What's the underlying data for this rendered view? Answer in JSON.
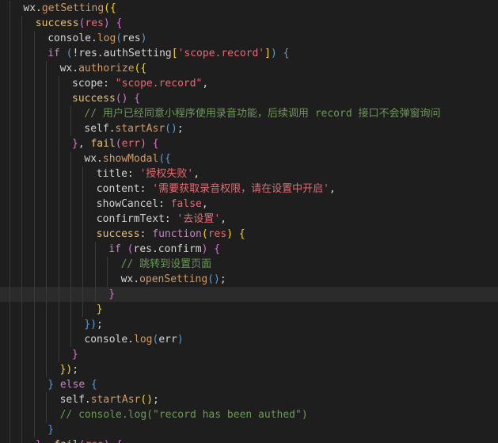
{
  "editor": {
    "lines": [
      {
        "indent": 1,
        "tokens": [
          [
            "t-plain",
            "wx."
          ],
          [
            "t-method",
            "getSetting"
          ],
          [
            "t-brace",
            "({"
          ]
        ]
      },
      {
        "indent": 2,
        "tokens": [
          [
            "t-yellow",
            "success"
          ],
          [
            "t-brace2",
            "("
          ],
          [
            "t-pink",
            "res"
          ],
          [
            "t-brace2",
            ")"
          ],
          [
            "t-plain",
            " "
          ],
          [
            "t-brace2",
            "{"
          ]
        ]
      },
      {
        "indent": 3,
        "tokens": [
          [
            "t-plain",
            "console."
          ],
          [
            "t-method",
            "log"
          ],
          [
            "t-brace3",
            "("
          ],
          [
            "t-plain",
            "res"
          ],
          [
            "t-brace3",
            ")"
          ]
        ]
      },
      {
        "indent": 3,
        "tokens": [
          [
            "t-kw",
            "if"
          ],
          [
            "t-plain",
            " "
          ],
          [
            "t-brace3",
            "("
          ],
          [
            "t-plain",
            "!res.authSetting"
          ],
          [
            "t-brace",
            "["
          ],
          [
            "t-strE",
            "'scope.record'"
          ],
          [
            "t-brace",
            "]"
          ],
          [
            "t-brace3",
            ")"
          ],
          [
            "t-plain",
            " "
          ],
          [
            "t-brace3",
            "{"
          ]
        ]
      },
      {
        "indent": 4,
        "tokens": [
          [
            "t-plain",
            "wx."
          ],
          [
            "t-method",
            "authorize"
          ],
          [
            "t-brace",
            "({"
          ]
        ]
      },
      {
        "indent": 5,
        "tokens": [
          [
            "t-plain",
            "scope: "
          ],
          [
            "t-strE",
            "\"scope.record\""
          ],
          [
            "t-plain",
            ","
          ]
        ]
      },
      {
        "indent": 5,
        "tokens": [
          [
            "t-yellow",
            "success"
          ],
          [
            "t-brace2",
            "()"
          ],
          [
            "t-plain",
            " "
          ],
          [
            "t-brace2",
            "{"
          ]
        ]
      },
      {
        "indent": 6,
        "tokens": [
          [
            "t-cm",
            "// 用户已经同意小程序使用录音功能，后续调用 record 接口不会弹窗询问"
          ]
        ]
      },
      {
        "indent": 6,
        "tokens": [
          [
            "t-plain",
            "self."
          ],
          [
            "t-method",
            "startAsr"
          ],
          [
            "t-brace3",
            "()"
          ],
          [
            "t-plain",
            ";"
          ]
        ]
      },
      {
        "indent": 5,
        "tokens": [
          [
            "t-brace2",
            "}"
          ],
          [
            "t-plain",
            ", "
          ],
          [
            "t-yellow",
            "fail"
          ],
          [
            "t-brace2",
            "("
          ],
          [
            "t-pink",
            "err"
          ],
          [
            "t-brace2",
            ")"
          ],
          [
            "t-plain",
            " "
          ],
          [
            "t-brace2",
            "{"
          ]
        ]
      },
      {
        "indent": 6,
        "tokens": [
          [
            "t-plain",
            "wx."
          ],
          [
            "t-method",
            "showModal"
          ],
          [
            "t-brace3",
            "({"
          ]
        ]
      },
      {
        "indent": 7,
        "tokens": [
          [
            "t-plain",
            "title: "
          ],
          [
            "t-strE",
            "'授权失败'"
          ],
          [
            "t-plain",
            ","
          ]
        ]
      },
      {
        "indent": 7,
        "tokens": [
          [
            "t-plain",
            "content: "
          ],
          [
            "t-strE",
            "'需要获取录音权限，请在设置中开启'"
          ],
          [
            "t-plain",
            ","
          ]
        ]
      },
      {
        "indent": 7,
        "tokens": [
          [
            "t-plain",
            "showCancel: "
          ],
          [
            "t-bool",
            "false"
          ],
          [
            "t-plain",
            ","
          ]
        ]
      },
      {
        "indent": 7,
        "tokens": [
          [
            "t-plain",
            "confirmText: "
          ],
          [
            "t-strE",
            "'去设置'"
          ],
          [
            "t-plain",
            ","
          ]
        ]
      },
      {
        "indent": 7,
        "tokens": [
          [
            "t-yellow",
            "success"
          ],
          [
            "t-plain",
            ": "
          ],
          [
            "t-kw",
            "function"
          ],
          [
            "t-brace",
            "("
          ],
          [
            "t-pink",
            "res"
          ],
          [
            "t-brace",
            ")"
          ],
          [
            "t-plain",
            " "
          ],
          [
            "t-brace",
            "{"
          ]
        ]
      },
      {
        "indent": 8,
        "tokens": [
          [
            "t-kw",
            "if"
          ],
          [
            "t-plain",
            " "
          ],
          [
            "t-brace2",
            "("
          ],
          [
            "t-plain",
            "res.confirm"
          ],
          [
            "t-brace2",
            ")"
          ],
          [
            "t-plain",
            " "
          ],
          [
            "t-brace2",
            "{"
          ]
        ]
      },
      {
        "indent": 9,
        "tokens": [
          [
            "t-cm",
            "// 跳转到设置页面"
          ]
        ]
      },
      {
        "indent": 9,
        "tokens": [
          [
            "t-plain",
            "wx."
          ],
          [
            "t-method",
            "openSetting"
          ],
          [
            "t-brace3",
            "()"
          ],
          [
            "t-plain",
            ";"
          ]
        ]
      },
      {
        "indent": 8,
        "tokens": [
          [
            "t-brace2",
            "}"
          ]
        ]
      },
      {
        "indent": 7,
        "tokens": [
          [
            "t-brace",
            "}"
          ]
        ]
      },
      {
        "indent": 6,
        "tokens": [
          [
            "t-brace3",
            "})"
          ],
          [
            "t-plain",
            ";"
          ]
        ]
      },
      {
        "indent": 6,
        "tokens": [
          [
            "t-plain",
            "console."
          ],
          [
            "t-method",
            "log"
          ],
          [
            "t-brace3",
            "("
          ],
          [
            "t-plain",
            "err"
          ],
          [
            "t-brace3",
            ")"
          ]
        ]
      },
      {
        "indent": 5,
        "tokens": [
          [
            "t-brace2",
            "}"
          ]
        ]
      },
      {
        "indent": 4,
        "tokens": [
          [
            "t-brace",
            "})"
          ],
          [
            "t-plain",
            ";"
          ]
        ]
      },
      {
        "indent": 3,
        "tokens": [
          [
            "t-brace3",
            "}"
          ],
          [
            "t-plain",
            " "
          ],
          [
            "t-kw",
            "else"
          ],
          [
            "t-plain",
            " "
          ],
          [
            "t-brace3",
            "{"
          ]
        ]
      },
      {
        "indent": 4,
        "tokens": [
          [
            "t-plain",
            "self."
          ],
          [
            "t-method",
            "startAsr"
          ],
          [
            "t-brace",
            "()"
          ],
          [
            "t-plain",
            ";"
          ]
        ]
      },
      {
        "indent": 4,
        "tokens": [
          [
            "t-cm",
            "// console.log(\"record has been authed\")"
          ]
        ]
      },
      {
        "indent": 3,
        "tokens": [
          [
            "t-brace3",
            "}"
          ]
        ]
      },
      {
        "indent": 2,
        "tokens": [
          [
            "t-brace2",
            "}"
          ],
          [
            "t-plain",
            ", "
          ],
          [
            "t-yellow",
            "fail"
          ],
          [
            "t-brace2",
            "("
          ],
          [
            "t-pink",
            "res"
          ],
          [
            "t-brace2",
            ")"
          ],
          [
            "t-plain",
            " "
          ],
          [
            "t-brace2",
            "{"
          ]
        ]
      }
    ],
    "current_line": 19
  }
}
